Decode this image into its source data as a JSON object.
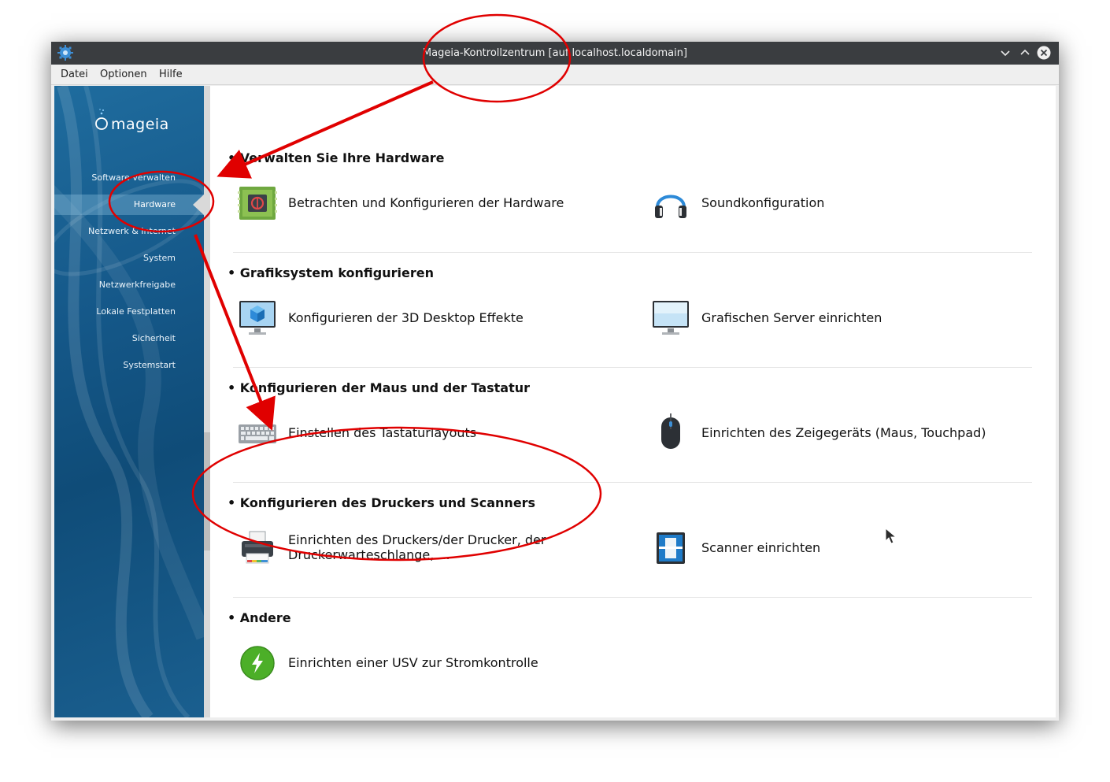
{
  "window": {
    "title": "Mageia-Kontrollzentrum [auf localhost.localdomain]"
  },
  "menubar": {
    "items": [
      "Datei",
      "Optionen",
      "Hilfe"
    ]
  },
  "sidebar": {
    "logo_text": "mageia",
    "items": [
      {
        "label": "Software verwalten"
      },
      {
        "label": "Hardware",
        "selected": true
      },
      {
        "label": "Netzwerk & Internet"
      },
      {
        "label": "System"
      },
      {
        "label": "Netzwerkfreigabe"
      },
      {
        "label": "Lokale Festplatten"
      },
      {
        "label": "Sicherheit"
      },
      {
        "label": "Systemstart"
      }
    ]
  },
  "sections": [
    {
      "title": "• Verwalten Sie Ihre Hardware",
      "tools": [
        {
          "label": "Betrachten und Konfigurieren der Hardware",
          "icon": "hardware-board-icon"
        },
        {
          "label": "Soundkonfiguration",
          "icon": "headphones-icon"
        }
      ]
    },
    {
      "title": "• Grafiksystem konfigurieren",
      "tools": [
        {
          "label": "Konfigurieren der 3D Desktop Effekte",
          "icon": "monitor-3d-cube-icon"
        },
        {
          "label": "Grafischen Server einrichten",
          "icon": "monitor-icon"
        }
      ]
    },
    {
      "title": "• Konfigurieren der Maus und der Tastatur",
      "tools": [
        {
          "label": "Einstellen des Tastaturlayouts",
          "icon": "keyboard-icon"
        },
        {
          "label": "Einrichten des Zeigegeräts (Maus, Touchpad)",
          "icon": "mouse-icon"
        }
      ]
    },
    {
      "title": "• Konfigurieren des Druckers und Scanners",
      "tools": [
        {
          "label": "Einrichten des Druckers/der Drucker, der Druckerwarteschlange, ...",
          "icon": "printer-icon"
        },
        {
          "label": "Scanner einrichten",
          "icon": "scanner-icon"
        }
      ]
    },
    {
      "title": "• Andere",
      "tools": [
        {
          "label": "Einrichten einer USV zur Stromkontrolle",
          "icon": "power-lightning-icon"
        }
      ]
    }
  ],
  "colors": {
    "titlebar": "#3a3d40",
    "sidebar": "#155889",
    "annotation": "#e00000"
  }
}
